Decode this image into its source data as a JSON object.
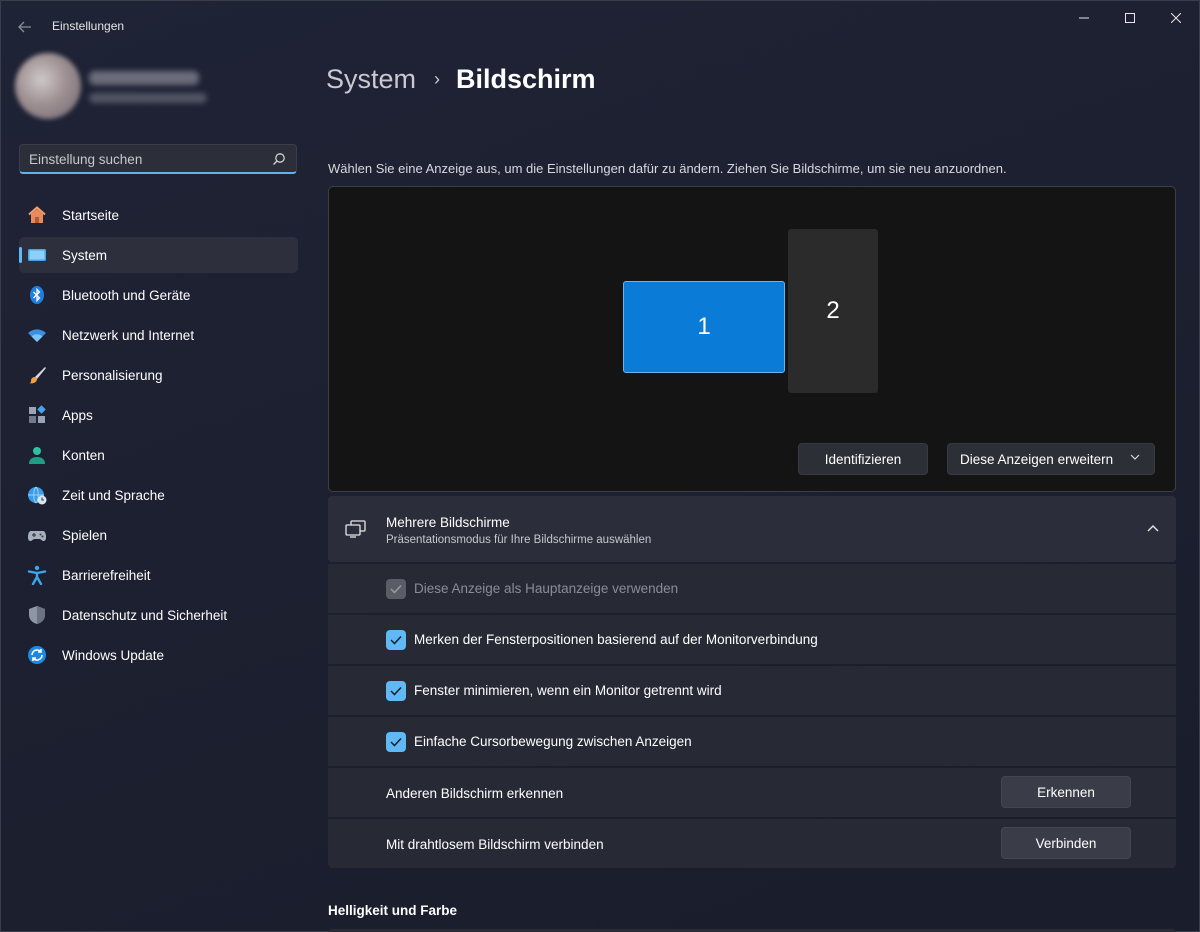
{
  "app": {
    "title": "Einstellungen"
  },
  "search": {
    "placeholder": "Einstellung suchen",
    "value": ""
  },
  "sidebar": {
    "items": [
      {
        "label": "Startseite",
        "icon": "home-icon"
      },
      {
        "label": "System",
        "icon": "monitor-icon",
        "active": true
      },
      {
        "label": "Bluetooth und Geräte",
        "icon": "bluetooth-icon"
      },
      {
        "label": "Netzwerk und Internet",
        "icon": "wifi-icon"
      },
      {
        "label": "Personalisierung",
        "icon": "brush-icon"
      },
      {
        "label": "Apps",
        "icon": "apps-icon"
      },
      {
        "label": "Konten",
        "icon": "person-icon"
      },
      {
        "label": "Zeit und Sprache",
        "icon": "globe-clock-icon"
      },
      {
        "label": "Spielen",
        "icon": "gamepad-icon"
      },
      {
        "label": "Barrierefreiheit",
        "icon": "accessibility-icon"
      },
      {
        "label": "Datenschutz und Sicherheit",
        "icon": "shield-icon"
      },
      {
        "label": "Windows Update",
        "icon": "update-icon"
      }
    ]
  },
  "breadcrumb": {
    "parent": "System",
    "separator": "›",
    "current": "Bildschirm"
  },
  "display": {
    "instruction": "Wählen Sie eine Anzeige aus, um die Einstellungen dafür zu ändern. Ziehen Sie Bildschirme, um sie neu anzuordnen.",
    "monitors": [
      {
        "number": "1",
        "selected": true
      },
      {
        "number": "2",
        "selected": false
      }
    ],
    "identify_label": "Identifizieren",
    "mode_label": "Diese Anzeigen erweitern"
  },
  "multiple": {
    "title": "Mehrere Bildschirme",
    "subtitle": "Präsentationsmodus für Ihre Bildschirme auswählen",
    "expanded": true,
    "options": [
      {
        "label": "Diese Anzeige als Hauptanzeige verwenden",
        "checked": true,
        "disabled": true
      },
      {
        "label": "Merken der Fensterpositionen basierend auf der Monitorverbindung",
        "checked": true,
        "disabled": false
      },
      {
        "label": "Fenster minimieren, wenn ein Monitor getrennt wird",
        "checked": true,
        "disabled": false
      },
      {
        "label": "Einfache Cursorbewegung zwischen Anzeigen",
        "checked": true,
        "disabled": false
      }
    ],
    "detect": {
      "label": "Anderen Bildschirm erkennen",
      "button": "Erkennen"
    },
    "wireless": {
      "label": "Mit drahtlosem Bildschirm verbinden",
      "button": "Verbinden"
    }
  },
  "sections": {
    "brightness_title": "Helligkeit und Farbe"
  },
  "colors": {
    "accent": "#60b8f4",
    "selected_monitor": "#0a7cd8"
  }
}
